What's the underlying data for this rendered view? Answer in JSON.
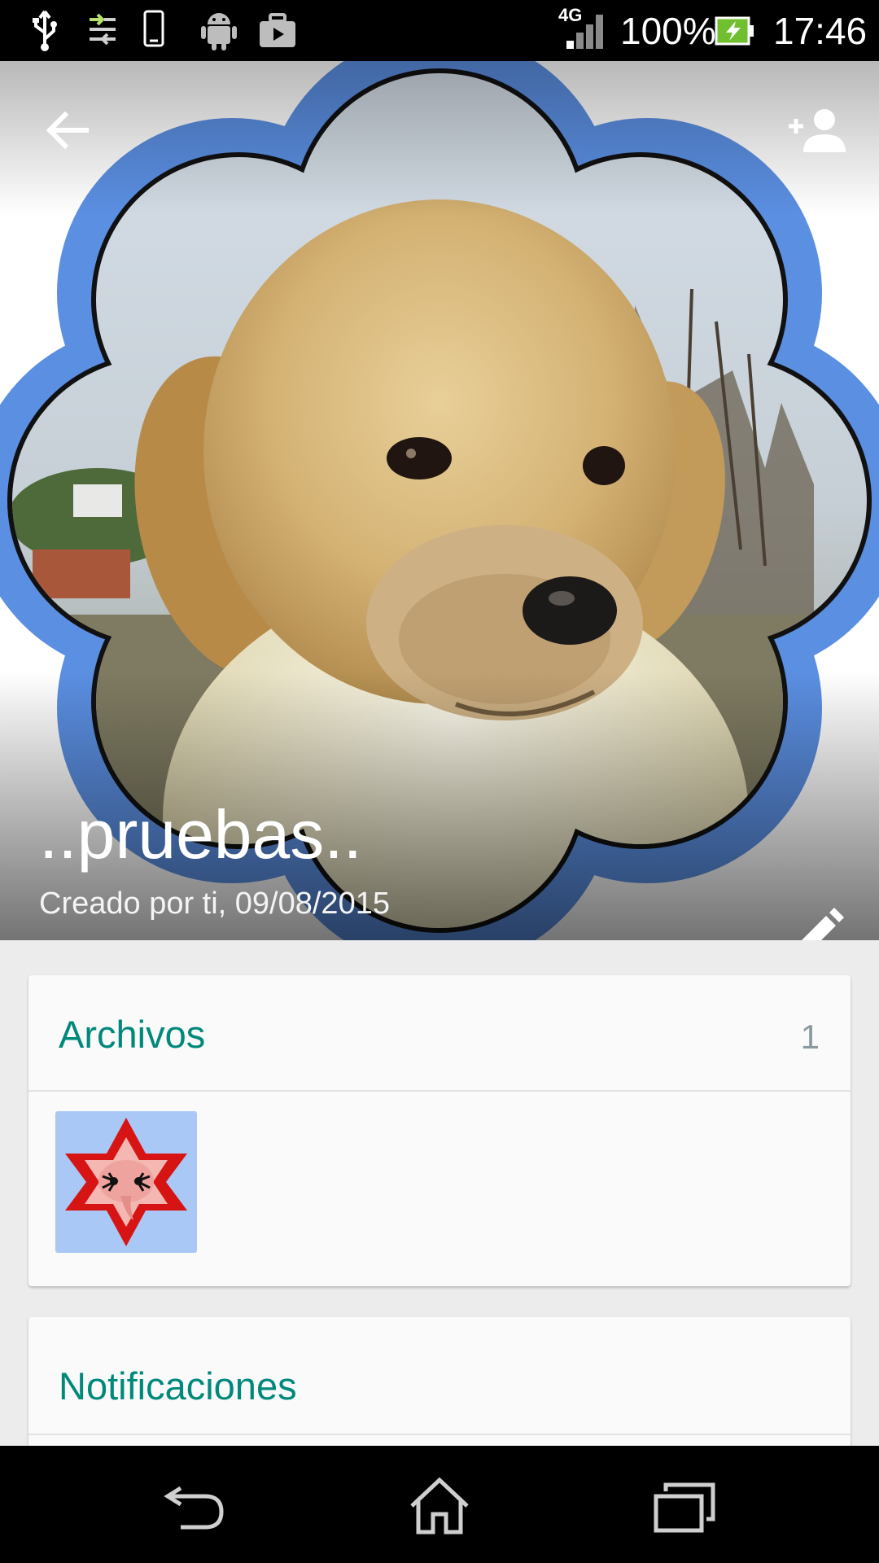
{
  "status_bar": {
    "network_label": "4G",
    "battery_percent": "100%",
    "time": "17:46",
    "icons": [
      "usb-icon",
      "data-transfer-icon",
      "phone-outline-icon",
      "android-icon",
      "briefcase-play-icon",
      "signal-icon",
      "battery-charging-icon"
    ]
  },
  "header": {
    "group_name": "..pruebas..",
    "created_info": "Creado por ti, 09/08/2015",
    "back_icon": "arrow-back-icon",
    "add_icon": "add-person-icon",
    "edit_icon": "pencil-icon"
  },
  "files_card": {
    "title": "Archivos",
    "count": "1"
  },
  "notifications_card": {
    "title": "Notificaciones"
  },
  "nav_bar": {
    "icons": [
      "back-nav-icon",
      "home-icon",
      "recent-apps-icon"
    ]
  },
  "colors": {
    "accent": "#00897b",
    "flower_frame": "#5a8fe0",
    "count_text": "#8a9a9e"
  }
}
